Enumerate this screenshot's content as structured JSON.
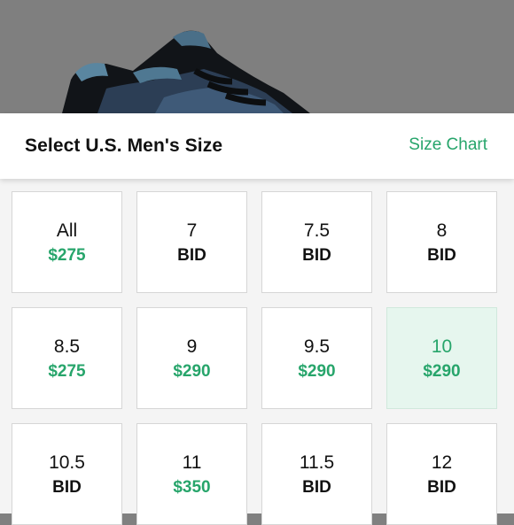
{
  "header": {
    "title": "Select U.S. Men's Size",
    "size_chart_label": "Size Chart"
  },
  "colors": {
    "accent": "#27a56b",
    "selected_bg": "#e6f6ee",
    "overlay": "#808080"
  },
  "backdrop": {
    "icon": "sneaker-product-image"
  },
  "sizes": [
    {
      "label": "All",
      "price": "$275",
      "has_price": true,
      "selected": false
    },
    {
      "label": "7",
      "price": "BID",
      "has_price": false,
      "selected": false
    },
    {
      "label": "7.5",
      "price": "BID",
      "has_price": false,
      "selected": false
    },
    {
      "label": "8",
      "price": "BID",
      "has_price": false,
      "selected": false
    },
    {
      "label": "8.5",
      "price": "$275",
      "has_price": true,
      "selected": false
    },
    {
      "label": "9",
      "price": "$290",
      "has_price": true,
      "selected": false
    },
    {
      "label": "9.5",
      "price": "$290",
      "has_price": true,
      "selected": false
    },
    {
      "label": "10",
      "price": "$290",
      "has_price": true,
      "selected": true
    },
    {
      "label": "10.5",
      "price": "BID",
      "has_price": false,
      "selected": false
    },
    {
      "label": "11",
      "price": "$350",
      "has_price": true,
      "selected": false
    },
    {
      "label": "11.5",
      "price": "BID",
      "has_price": false,
      "selected": false
    },
    {
      "label": "12",
      "price": "BID",
      "has_price": false,
      "selected": false
    }
  ]
}
